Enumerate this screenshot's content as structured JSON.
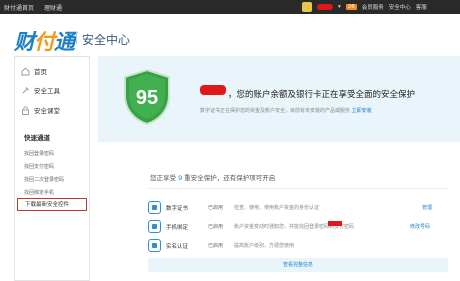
{
  "topbar": {
    "links": [
      "财付通首页",
      "理财通"
    ],
    "right_items": [
      "会员服务",
      "安全中心",
      "客服"
    ],
    "badge": "26",
    "extra": "·"
  },
  "header": {
    "logo_a": "财",
    "logo_b": "付",
    "logo_c": "通",
    "title": "安全中心"
  },
  "sidebar": {
    "nav": [
      "首页",
      "安全工具",
      "安全课堂"
    ],
    "quick_title": "快速通道",
    "quick_links": [
      "找回登录密码",
      "找回支付密码",
      "找回二次登录密码",
      "找回绑定手机",
      "下载最新安全控件"
    ]
  },
  "hero": {
    "score": "95",
    "title": "，您的账户余额及银行卡正在享受全面的安全保护",
    "subtitle": "数字证书正在保护您的资金及账户安全，目前有未安装的产品或服务",
    "subtitle_link": "立即安装"
  },
  "status": {
    "prefix": "您正享受",
    "count": "9",
    "suffix": "重安全保护，还有保护项可开启"
  },
  "items": [
    {
      "name": "数字证书",
      "state": "已启用",
      "desc": "检查、使用、使用账户资金的身份认证",
      "action": "管理"
    },
    {
      "name": "手机绑定",
      "state": "已启用",
      "desc": "账户资金变动时通知您，并能找回登录密码和支付密码",
      "action": "修改号码"
    },
    {
      "name": "实名认证",
      "state": "已启用",
      "desc": "提高账户级别，方便您使用",
      "action": ""
    }
  ],
  "more": "查看完整信息",
  "colors": {
    "accent": "#1d7fc7",
    "shield": "#3aa048",
    "alert": "#e01818"
  }
}
